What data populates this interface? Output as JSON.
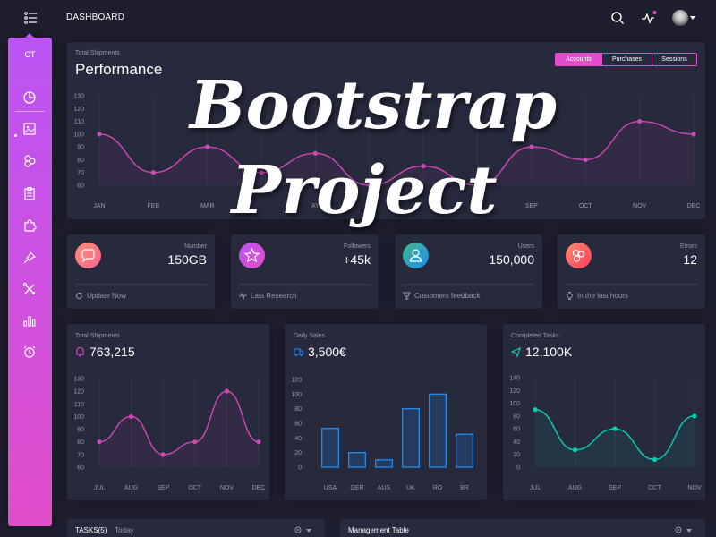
{
  "header": {
    "brand": "DASHBOARD",
    "icons": [
      "menu-icon",
      "search-icon",
      "activity-icon",
      "avatar",
      "caret-down-icon"
    ],
    "notification_color": "#e14eca"
  },
  "sidebar": {
    "logo": "CT",
    "gradient": [
      "#ba54f5",
      "#e14eca"
    ],
    "items": [
      {
        "icon": "chart-pie-icon"
      },
      {
        "icon": "image-icon"
      },
      {
        "icon": "atom-icon"
      },
      {
        "icon": "clipboard-icon"
      },
      {
        "icon": "puzzle-icon"
      },
      {
        "icon": "pin-icon"
      },
      {
        "icon": "tools-icon"
      },
      {
        "icon": "bar-chart-icon"
      },
      {
        "icon": "alarm-clock-icon"
      }
    ]
  },
  "watermark": {
    "line1": "Bootstrap",
    "line2": "Project"
  },
  "performance": {
    "category": "Total Shipments",
    "title": "Performance",
    "buttons": [
      "Accounts",
      "Purchases",
      "Sessions"
    ],
    "active_button": "Accounts"
  },
  "stats": [
    {
      "category": "Number",
      "value": "150GB",
      "footer": "Update Now",
      "icon": "chat-icon",
      "footer_icon": "refresh-icon",
      "color": "#fd5d93"
    },
    {
      "category": "Followers",
      "value": "+45k",
      "footer": "Last Research",
      "icon": "star-icon",
      "footer_icon": "sound-wave-icon",
      "color": "#ba54f5"
    },
    {
      "category": "Users",
      "value": "150,000",
      "footer": "Customers feedback",
      "icon": "user-icon",
      "footer_icon": "trophy-icon",
      "color": "#1d8cf8"
    },
    {
      "category": "Errors",
      "value": "12",
      "footer": "In the last hours",
      "icon": "molecule-icon",
      "footer_icon": "watch-icon",
      "color": "#fd5d93"
    }
  ],
  "shipments_card": {
    "category": "Total Shipments",
    "title": "763,215",
    "icon": "bell-icon"
  },
  "sales_card": {
    "category": "Daily Sales",
    "title": "3,500€",
    "icon": "delivery-icon"
  },
  "tasks_card": {
    "category": "Completed Tasks",
    "title": "12,100K",
    "icon": "send-icon"
  },
  "bottom": {
    "tasks_title": "TASKS(5)",
    "tasks_sub": "Today",
    "table_title": "Management Table"
  },
  "chart_data": [
    {
      "type": "line",
      "title": "Performance",
      "categories": [
        "JAN",
        "FEB",
        "MAR",
        "APR",
        "MAY",
        "JUN",
        "JUL",
        "AUG",
        "SEP",
        "OCT",
        "NOV",
        "DEC"
      ],
      "category_labels": [
        "JAN",
        "FEB",
        "MAR",
        "",
        "AY",
        "UN",
        "",
        "",
        "SEP",
        "OCT",
        "NOV",
        "DEC"
      ],
      "values": [
        100,
        70,
        90,
        70,
        85,
        60,
        75,
        60,
        90,
        80,
        110,
        100
      ],
      "ylim": [
        60,
        130
      ],
      "yticks": [
        60,
        70,
        80,
        90,
        100,
        110,
        120,
        130
      ],
      "color": "#d048b6",
      "grid": true
    },
    {
      "type": "line",
      "title": "763,215",
      "categories": [
        "JUL",
        "AUG",
        "SEP",
        "OCT",
        "NOV",
        "DEC"
      ],
      "values": [
        80,
        100,
        70,
        80,
        120,
        80
      ],
      "ylim": [
        60,
        130
      ],
      "yticks": [
        60,
        70,
        80,
        90,
        100,
        110,
        120,
        130
      ],
      "color": "#d048b6",
      "grid": true
    },
    {
      "type": "bar",
      "title": "3,500€",
      "categories": [
        "USA",
        "GER",
        "AUS",
        "UK",
        "RO",
        "BR"
      ],
      "values": [
        53,
        20,
        10,
        80,
        100,
        45
      ],
      "ylim": [
        0,
        120
      ],
      "yticks": [
        0,
        20,
        40,
        60,
        80,
        100,
        120
      ],
      "color": "#1f8ef1",
      "grid": true
    },
    {
      "type": "line",
      "title": "12,100K",
      "categories": [
        "JUL",
        "AUG",
        "SEP",
        "OCT",
        "NOV"
      ],
      "values": [
        90,
        27,
        60,
        12,
        80
      ],
      "ylim": [
        0,
        140
      ],
      "yticks": [
        0,
        20,
        40,
        60,
        80,
        100,
        120,
        140
      ],
      "color": "#00d6b4",
      "grid": true
    }
  ]
}
